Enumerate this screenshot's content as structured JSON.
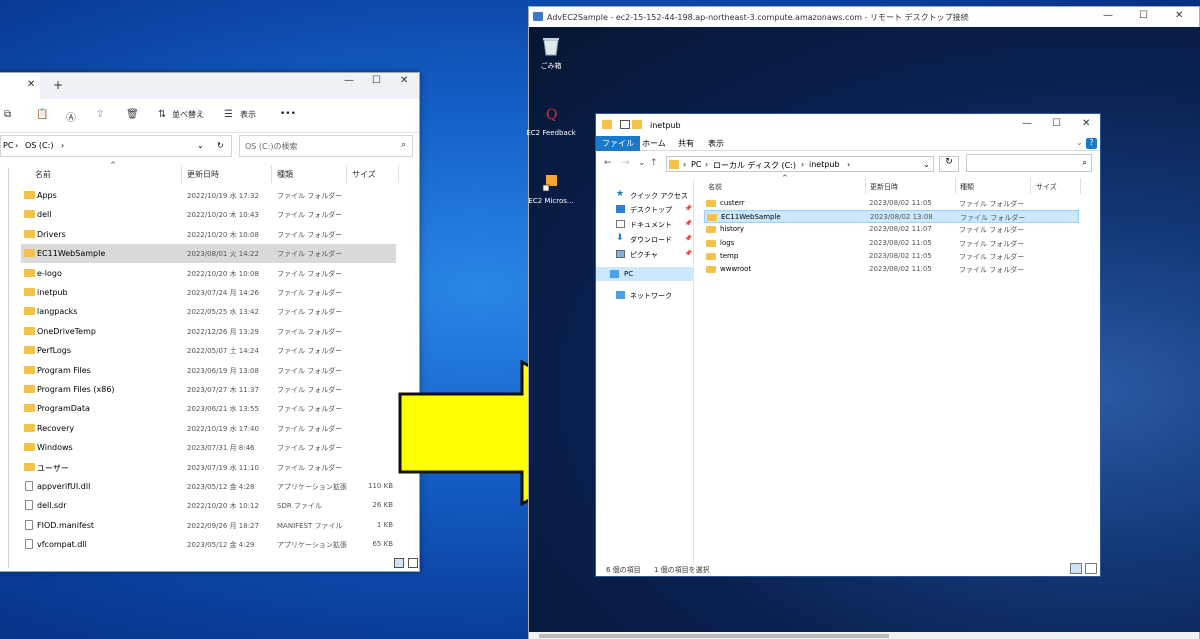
{
  "local": {
    "window_controls": {
      "minimize": "—",
      "maximize": "☐",
      "close": "✕"
    },
    "tab_close": "✕",
    "tab_add": "+",
    "toolbar": {
      "sort_label": "並べ替え",
      "view_label": "表示",
      "more": "•••"
    },
    "address": {
      "pc": "PC",
      "drive": "OS (C:)",
      "sep": "›",
      "dropdown": "⌄",
      "refresh": "↻"
    },
    "search_placeholder": "OS (C:)の検索",
    "headers": {
      "name": "名前",
      "date": "更新日時",
      "type": "種類",
      "size": "サイズ"
    },
    "sel_index": 3,
    "rows": [
      {
        "name": "Apps",
        "date": "2022/10/19 水 17:32",
        "type": "ファイル フォルダー",
        "size": "",
        "kind": "folder"
      },
      {
        "name": "dell",
        "date": "2022/10/20 木 10:43",
        "type": "ファイル フォルダー",
        "size": "",
        "kind": "folder"
      },
      {
        "name": "Drivers",
        "date": "2022/10/20 木 10:08",
        "type": "ファイル フォルダー",
        "size": "",
        "kind": "folder"
      },
      {
        "name": "EC11WebSample",
        "date": "2023/08/01 火 14:22",
        "type": "ファイル フォルダー",
        "size": "",
        "kind": "folder"
      },
      {
        "name": "e-logo",
        "date": "2022/10/20 木 10:08",
        "type": "ファイル フォルダー",
        "size": "",
        "kind": "folder"
      },
      {
        "name": "inetpub",
        "date": "2023/07/24 月 14:26",
        "type": "ファイル フォルダー",
        "size": "",
        "kind": "folder"
      },
      {
        "name": "langpacks",
        "date": "2022/05/25 水 13:42",
        "type": "ファイル フォルダー",
        "size": "",
        "kind": "folder"
      },
      {
        "name": "OneDriveTemp",
        "date": "2022/12/26 月 13:29",
        "type": "ファイル フォルダー",
        "size": "",
        "kind": "folder"
      },
      {
        "name": "PerfLogs",
        "date": "2022/05/07 土 14:24",
        "type": "ファイル フォルダー",
        "size": "",
        "kind": "folder"
      },
      {
        "name": "Program Files",
        "date": "2023/06/19 月 13:08",
        "type": "ファイル フォルダー",
        "size": "",
        "kind": "folder"
      },
      {
        "name": "Program Files (x86)",
        "date": "2023/07/27 木 11:37",
        "type": "ファイル フォルダー",
        "size": "",
        "kind": "folder"
      },
      {
        "name": "ProgramData",
        "date": "2023/06/21 水 13:55",
        "type": "ファイル フォルダー",
        "size": "",
        "kind": "folder"
      },
      {
        "name": "Recovery",
        "date": "2022/10/19 水 17:40",
        "type": "ファイル フォルダー",
        "size": "",
        "kind": "folder"
      },
      {
        "name": "Windows",
        "date": "2023/07/31 月 8:46",
        "type": "ファイル フォルダー",
        "size": "",
        "kind": "folder"
      },
      {
        "name": "ユーザー",
        "date": "2023/07/19 水 11:10",
        "type": "ファイル フォルダー",
        "size": "",
        "kind": "folder"
      },
      {
        "name": "appverifUI.dll",
        "date": "2023/05/12 金 4:28",
        "type": "アプリケーション拡張",
        "size": "110 KB",
        "kind": "file"
      },
      {
        "name": "dell.sdr",
        "date": "2022/10/20 木 10:12",
        "type": "SDR ファイル",
        "size": "26 KB",
        "kind": "file"
      },
      {
        "name": "FIOD.manifest",
        "date": "2022/09/26 月 18:27",
        "type": "MANIFEST ファイル",
        "size": "1 KB",
        "kind": "file"
      },
      {
        "name": "vfcompat.dll",
        "date": "2023/05/12 金 4:29",
        "type": "アプリケーション拡張",
        "size": "65 KB",
        "kind": "file"
      }
    ]
  },
  "arrow_color": "#ffff00",
  "rdp": {
    "title": "AdvEC2Sample - ec2-15-152-44-198.ap-northeast-3.compute.amazonaws.com - リモート デスクトップ接続",
    "window_controls": {
      "minimize": "—",
      "maximize": "☐",
      "close": "✕"
    },
    "desktop_icons": [
      {
        "label": "ごみ箱",
        "icon": "recycle-bin-icon"
      },
      {
        "label": "EC2 Feedback",
        "icon": "ec2-feedback-icon"
      },
      {
        "label": "EC2 Micros...",
        "icon": "ec2-shortcut-icon"
      }
    ],
    "explorer": {
      "title": "inetpub",
      "window_controls": {
        "minimize": "—",
        "maximize": "☐",
        "close": "✕"
      },
      "ribbon_tabs": [
        "ファイル",
        "ホーム",
        "共有",
        "表示"
      ],
      "ribbon_expand": "⌄",
      "help": "?",
      "nav": {
        "back": "←",
        "forward": "→",
        "recent": "⌄",
        "up": "↑"
      },
      "address": {
        "pc": "PC",
        "drive": "ローカル ディスク (C:)",
        "folder": "inetpub",
        "sep": "›",
        "dropdown": "⌄",
        "refresh": "↻"
      },
      "pin": "📌",
      "nav_items": [
        {
          "label": "クイック アクセス",
          "pinned": false
        },
        {
          "label": "デスクトップ",
          "pinned": true
        },
        {
          "label": "ドキュメント",
          "pinned": true
        },
        {
          "label": "ダウンロード",
          "pinned": true
        },
        {
          "label": "ピクチャ",
          "pinned": true
        },
        {
          "label": "PC",
          "pinned": false
        },
        {
          "label": "ネットワーク",
          "pinned": false
        }
      ],
      "headers": {
        "name": "名前",
        "date": "更新日時",
        "type": "種類",
        "size": "サイズ"
      },
      "sel_index": 1,
      "rows": [
        {
          "name": "custerr",
          "date": "2023/08/02 11:05",
          "type": "ファイル フォルダー"
        },
        {
          "name": "EC11WebSample",
          "date": "2023/08/02 13:08",
          "type": "ファイル フォルダー"
        },
        {
          "name": "history",
          "date": "2023/08/02 11:07",
          "type": "ファイル フォルダー"
        },
        {
          "name": "logs",
          "date": "2023/08/02 11:05",
          "type": "ファイル フォルダー"
        },
        {
          "name": "temp",
          "date": "2023/08/02 11:05",
          "type": "ファイル フォルダー"
        },
        {
          "name": "wwwroot",
          "date": "2023/08/02 11:05",
          "type": "ファイル フォルダー"
        }
      ],
      "status": {
        "count": "6 個の項目",
        "selected": "1 個の項目を選択"
      }
    }
  }
}
